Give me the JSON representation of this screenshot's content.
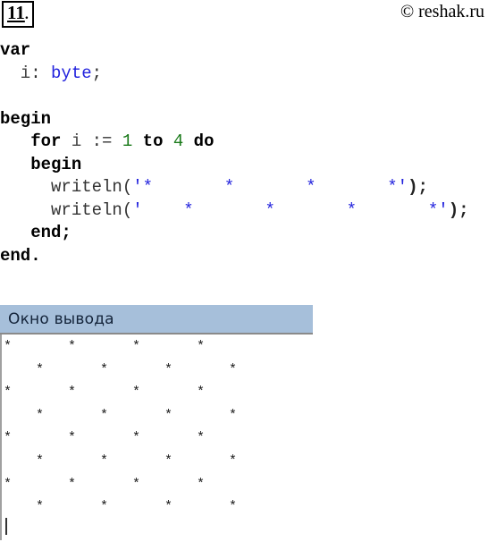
{
  "task": {
    "number": "11",
    "dot": "."
  },
  "watermark": {
    "text": "© reshak.ru"
  },
  "code": {
    "language": "pascal",
    "lines": [
      {
        "tokens": [
          {
            "t": "var",
            "c": "kw"
          }
        ]
      },
      {
        "tokens": [
          {
            "t": "  i",
            "c": "ident"
          },
          {
            "t": ": ",
            "c": "plain"
          },
          {
            "t": "byte",
            "c": "type"
          },
          {
            "t": ";",
            "c": "plain"
          }
        ]
      },
      {
        "tokens": [
          {
            "t": "",
            "c": "plain"
          }
        ]
      },
      {
        "tokens": [
          {
            "t": "begin",
            "c": "kw"
          }
        ]
      },
      {
        "tokens": [
          {
            "t": "   for ",
            "c": "kw"
          },
          {
            "t": "i ",
            "c": "ident"
          },
          {
            "t": ":= ",
            "c": "plain"
          },
          {
            "t": "1",
            "c": "num"
          },
          {
            "t": " to ",
            "c": "kw"
          },
          {
            "t": "4",
            "c": "num"
          },
          {
            "t": " do",
            "c": "kw"
          }
        ]
      },
      {
        "tokens": [
          {
            "t": "   begin",
            "c": "kw"
          }
        ]
      },
      {
        "tokens": [
          {
            "t": "     writeln(",
            "c": "plain"
          },
          {
            "t": "'*       *       *       *'",
            "c": "str"
          },
          {
            "t": ");",
            "c": "punct"
          }
        ]
      },
      {
        "tokens": [
          {
            "t": "     writeln(",
            "c": "plain"
          },
          {
            "t": "'    *       *       *       *'",
            "c": "str"
          },
          {
            "t": ");",
            "c": "punct"
          }
        ]
      },
      {
        "tokens": [
          {
            "t": "   end;",
            "c": "kw"
          }
        ]
      },
      {
        "tokens": [
          {
            "t": "end.",
            "c": "kw"
          }
        ]
      }
    ]
  },
  "output_window": {
    "title": "Окно вывода",
    "titlebar_color": "#a6bfda",
    "body_color": "#ffffff",
    "lines": [
      "*       *       *       *",
      "    *       *       *       *",
      "*       *       *       *",
      "    *       *       *       *",
      "*       *       *       *",
      "    *       *       *       *",
      "*       *       *       *",
      "    *       *       *       *"
    ],
    "caret_visible": true
  }
}
